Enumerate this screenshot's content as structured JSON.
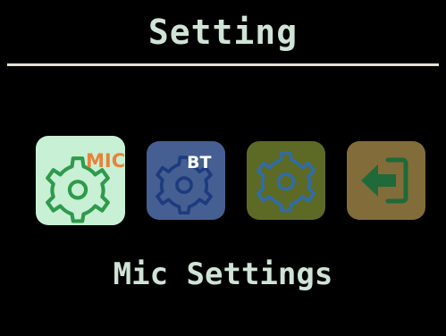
{
  "screen": {
    "title": "Setting",
    "caption": "Mic Settings"
  },
  "colors": {
    "background": "#000000",
    "text": "#cfe3d6",
    "divider": "#e6e0d6"
  },
  "menu": {
    "selected": "mic",
    "items": [
      {
        "id": "mic",
        "badge": "MIC",
        "icon": "mic-settings-gear-icon",
        "tile_color": "#c8f0d4",
        "icon_color": "#2f9a4c",
        "badge_color": "#e8823a"
      },
      {
        "id": "bt",
        "badge": "BT",
        "icon": "bluetooth-settings-gear-icon",
        "tile_color": "#465f92",
        "icon_color": "#1d3b7e",
        "badge_color": "#ffffff"
      },
      {
        "id": "general",
        "icon": "general-settings-gear-icon",
        "tile_color": "#5c6a25",
        "icon_color": "#2f6ca8"
      },
      {
        "id": "exit",
        "icon": "exit-arrow-icon",
        "tile_color": "#826c3a",
        "icon_color": "#1f6a38"
      }
    ]
  }
}
